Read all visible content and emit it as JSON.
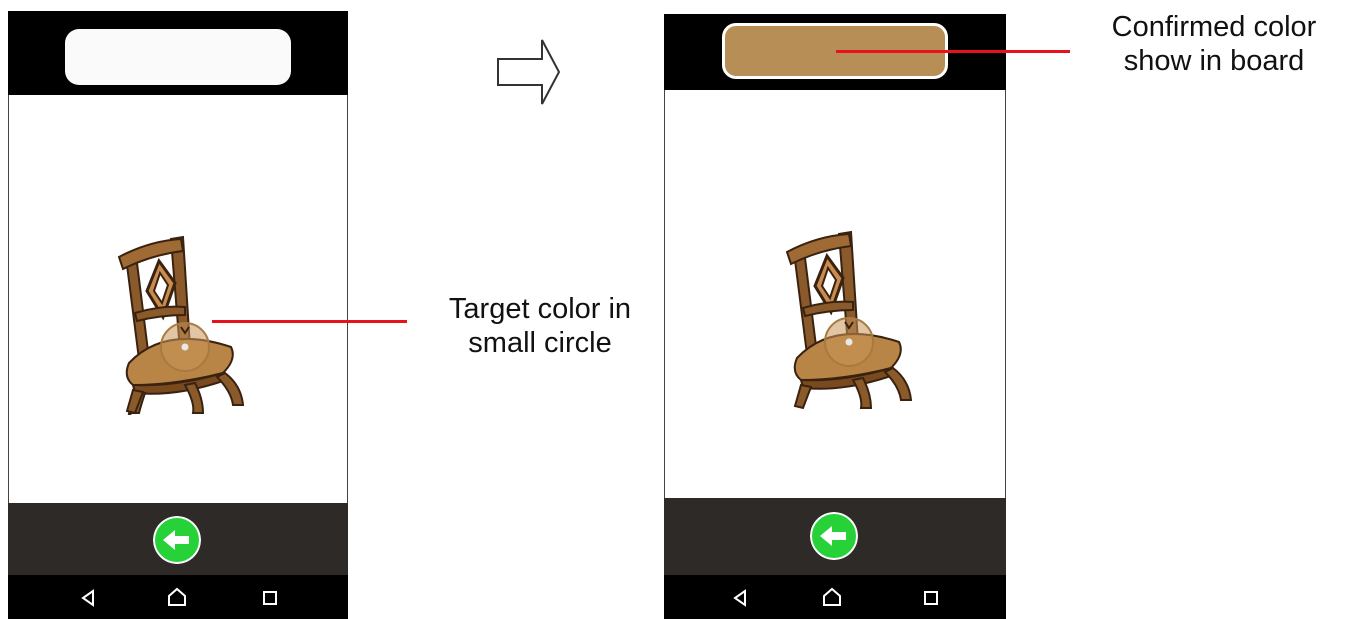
{
  "annotations": {
    "target": {
      "line1": "Target color in",
      "line2": "small circle"
    },
    "confirmed": {
      "line1": "Confirmed color",
      "line2": "show in board"
    }
  },
  "screens": {
    "before": {
      "board_color": "#fafafa",
      "board_state": "empty"
    },
    "after": {
      "board_color": "#b88e57",
      "board_state": "filled"
    }
  },
  "colors": {
    "topbar": "#000000",
    "bottombar": "#2d2a28",
    "navbar": "#000000",
    "back_button": "#27d138",
    "annotation_line": "#e8121c",
    "picked_color": "#b88e57"
  },
  "icons": {
    "back": "left-arrow-icon",
    "nav_back": "triangle-back-icon",
    "nav_home": "home-icon",
    "nav_recents": "square-recents-icon",
    "transition": "right-arrow-icon",
    "picker": "color-picker-circle-icon"
  }
}
